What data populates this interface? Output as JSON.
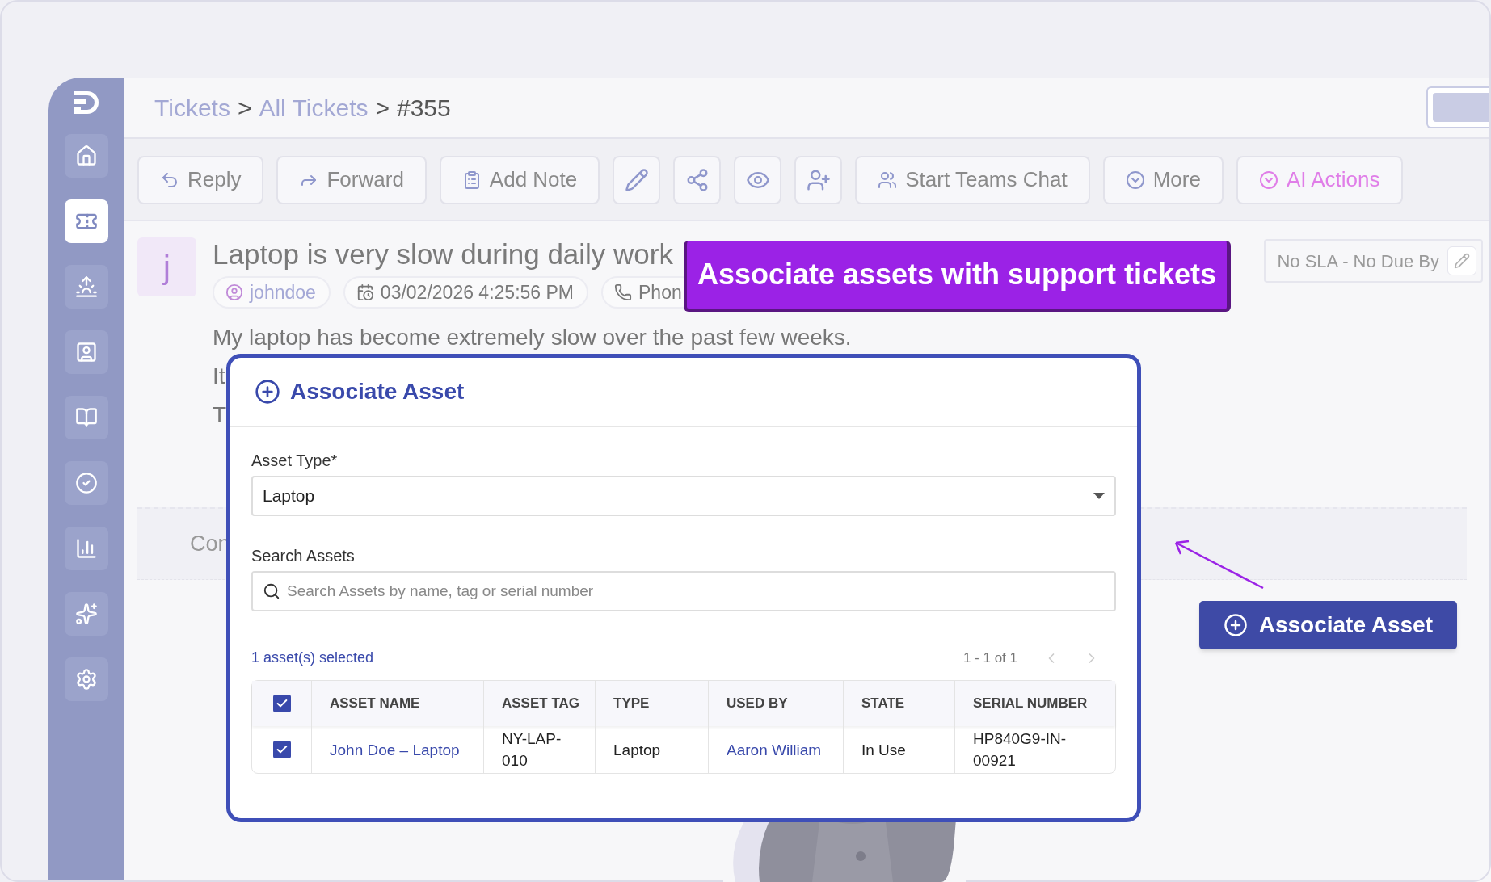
{
  "sidebar": {
    "items": [
      {
        "kind": "home",
        "selected": false
      },
      {
        "kind": "tickets",
        "selected": true
      },
      {
        "kind": "alerts",
        "selected": false
      },
      {
        "kind": "contacts",
        "selected": false
      },
      {
        "kind": "knowledge",
        "selected": false
      },
      {
        "kind": "tasks",
        "selected": false
      },
      {
        "kind": "reports",
        "selected": false
      },
      {
        "kind": "ai",
        "selected": false
      },
      {
        "kind": "settings",
        "selected": false
      }
    ]
  },
  "breadcrumb": [
    {
      "label": "Tickets",
      "kind": "link"
    },
    {
      "label": ">",
      "kind": "sep"
    },
    {
      "label": "All Tickets",
      "kind": "link"
    },
    {
      "label": ">",
      "kind": "sep"
    },
    {
      "label": "#355",
      "kind": "current"
    }
  ],
  "toolbar": [
    {
      "kind": "reply",
      "label": "Reply"
    },
    {
      "kind": "forward",
      "label": "Forward"
    },
    {
      "kind": "note",
      "label": "Add Note"
    },
    {
      "kind": "edit"
    },
    {
      "kind": "share"
    },
    {
      "kind": "watch"
    },
    {
      "kind": "assign"
    },
    {
      "kind": "teams",
      "label": "Start Teams Chat"
    },
    {
      "kind": "more",
      "label": "More"
    },
    {
      "kind": "ai",
      "label": "AI Actions"
    }
  ],
  "ticket": {
    "avatar": "j",
    "title": "Laptop is very slow during daily work",
    "chips": [
      {
        "kind": "user",
        "label": "johndoe"
      },
      {
        "kind": "date",
        "label": "03/02/2026 4:25:56 PM"
      },
      {
        "kind": "phone",
        "label": "Phon"
      }
    ],
    "sla": "No SLA - No Due By",
    "body": [
      "My laptop has become extremely slow over the past few weeks.",
      "It",
      "T"
    ],
    "section_tab": "Con"
  },
  "banner": "Associate assets with support tickets",
  "associate_button": "Associate Asset",
  "dialog": {
    "title": "Associate Asset",
    "asset_type": {
      "label": "Asset Type*",
      "value": "Laptop"
    },
    "search": {
      "label": "Search Assets",
      "placeholder": "Search Assets by name, tag or serial number"
    },
    "selected_count": "1 asset(s) selected",
    "pagination": "1 - 1 of 1",
    "table": {
      "all_checked": true,
      "columns": [
        "ASSET NAME",
        "ASSET TAG",
        "TYPE",
        "USED BY",
        "STATE",
        "SERIAL NUMBER"
      ],
      "rows": [
        {
          "checked": true,
          "cells": [
            "John Doe – Laptop",
            "NY-LAP-010",
            "Laptop",
            "Aaron William",
            "In Use",
            "HP840G9-IN-00921"
          ]
        }
      ]
    }
  }
}
